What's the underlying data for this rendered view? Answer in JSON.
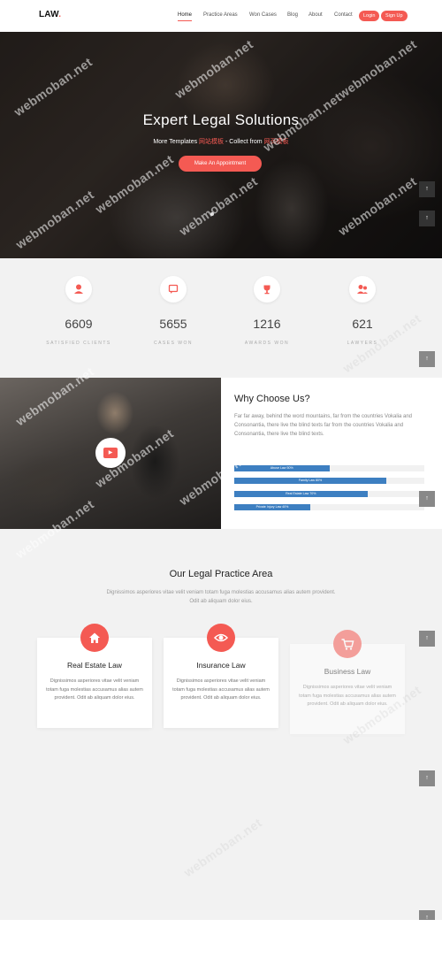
{
  "nav": {
    "logo": "LAW",
    "logo_dot": ".",
    "items": [
      "Home",
      "Practice Areas",
      "Won Cases",
      "Blog",
      "About",
      "Contact"
    ],
    "login": "Login",
    "signup": "Sign Up"
  },
  "hero": {
    "title": "Expert Legal Solutions",
    "subtitle_prefix": "More Templates ",
    "subtitle_link1": "网站模板",
    "subtitle_middle": " - Collect from ",
    "subtitle_link2": "网页模板",
    "button": "Make An Appointment"
  },
  "stats": [
    {
      "number": "6609",
      "label": "Satisfied Clients",
      "icon": "user-icon"
    },
    {
      "number": "5655",
      "label": "Cases Won",
      "icon": "chat-icon"
    },
    {
      "number": "1216",
      "label": "Awards Won",
      "icon": "trophy-icon"
    },
    {
      "number": "621",
      "label": "Lawyers",
      "icon": "people-icon"
    }
  ],
  "why": {
    "title": "Why Choose Us?",
    "text": "Far far away, behind the word mountains, far from the countries Vokalia and Consonantia, there live the blind texts far from the countries Vokalia and Consonantia, there live the blind texts.",
    "bars": [
      {
        "label": "Abuse Law 50%",
        "value": 50
      },
      {
        "label": "Family Law 80%",
        "value": 80
      },
      {
        "label": "Real Estate Law 70%",
        "value": 70
      },
      {
        "label": "Private Injury Law 40%",
        "value": 40
      }
    ]
  },
  "practice": {
    "title": "Our Legal Practice Area",
    "subtitle": "Dignissimos asperiores vitae velit veniam totam fuga molestias accusamus alias autem provident. Odit ab aliquam dolor eius.",
    "cards": [
      {
        "title": "Real Estate Law",
        "text": "Dignissimos asperiores vitae velit veniam totam fuga molestias accusamus alias autem provident. Odit ab aliquam dolor eius.",
        "icon": "home-icon"
      },
      {
        "title": "Insurance Law",
        "text": "Dignissimos asperiores vitae velit veniam totam fuga molestias accusamus alias autem provident. Odit ab aliquam dolor eius.",
        "icon": "eye-icon"
      },
      {
        "title": "Business Law",
        "text": "Dignissimos asperiores vitae velit veniam totam fuga molestias accusamus alias autem provident. Odit ab aliquam dolor eius.",
        "icon": "cart-icon"
      }
    ]
  },
  "scroll_top": "↑",
  "watermark": "webmoban.net",
  "colors": {
    "accent": "#f45a53",
    "bar": "#3d7fc1",
    "dark": "#222222"
  }
}
